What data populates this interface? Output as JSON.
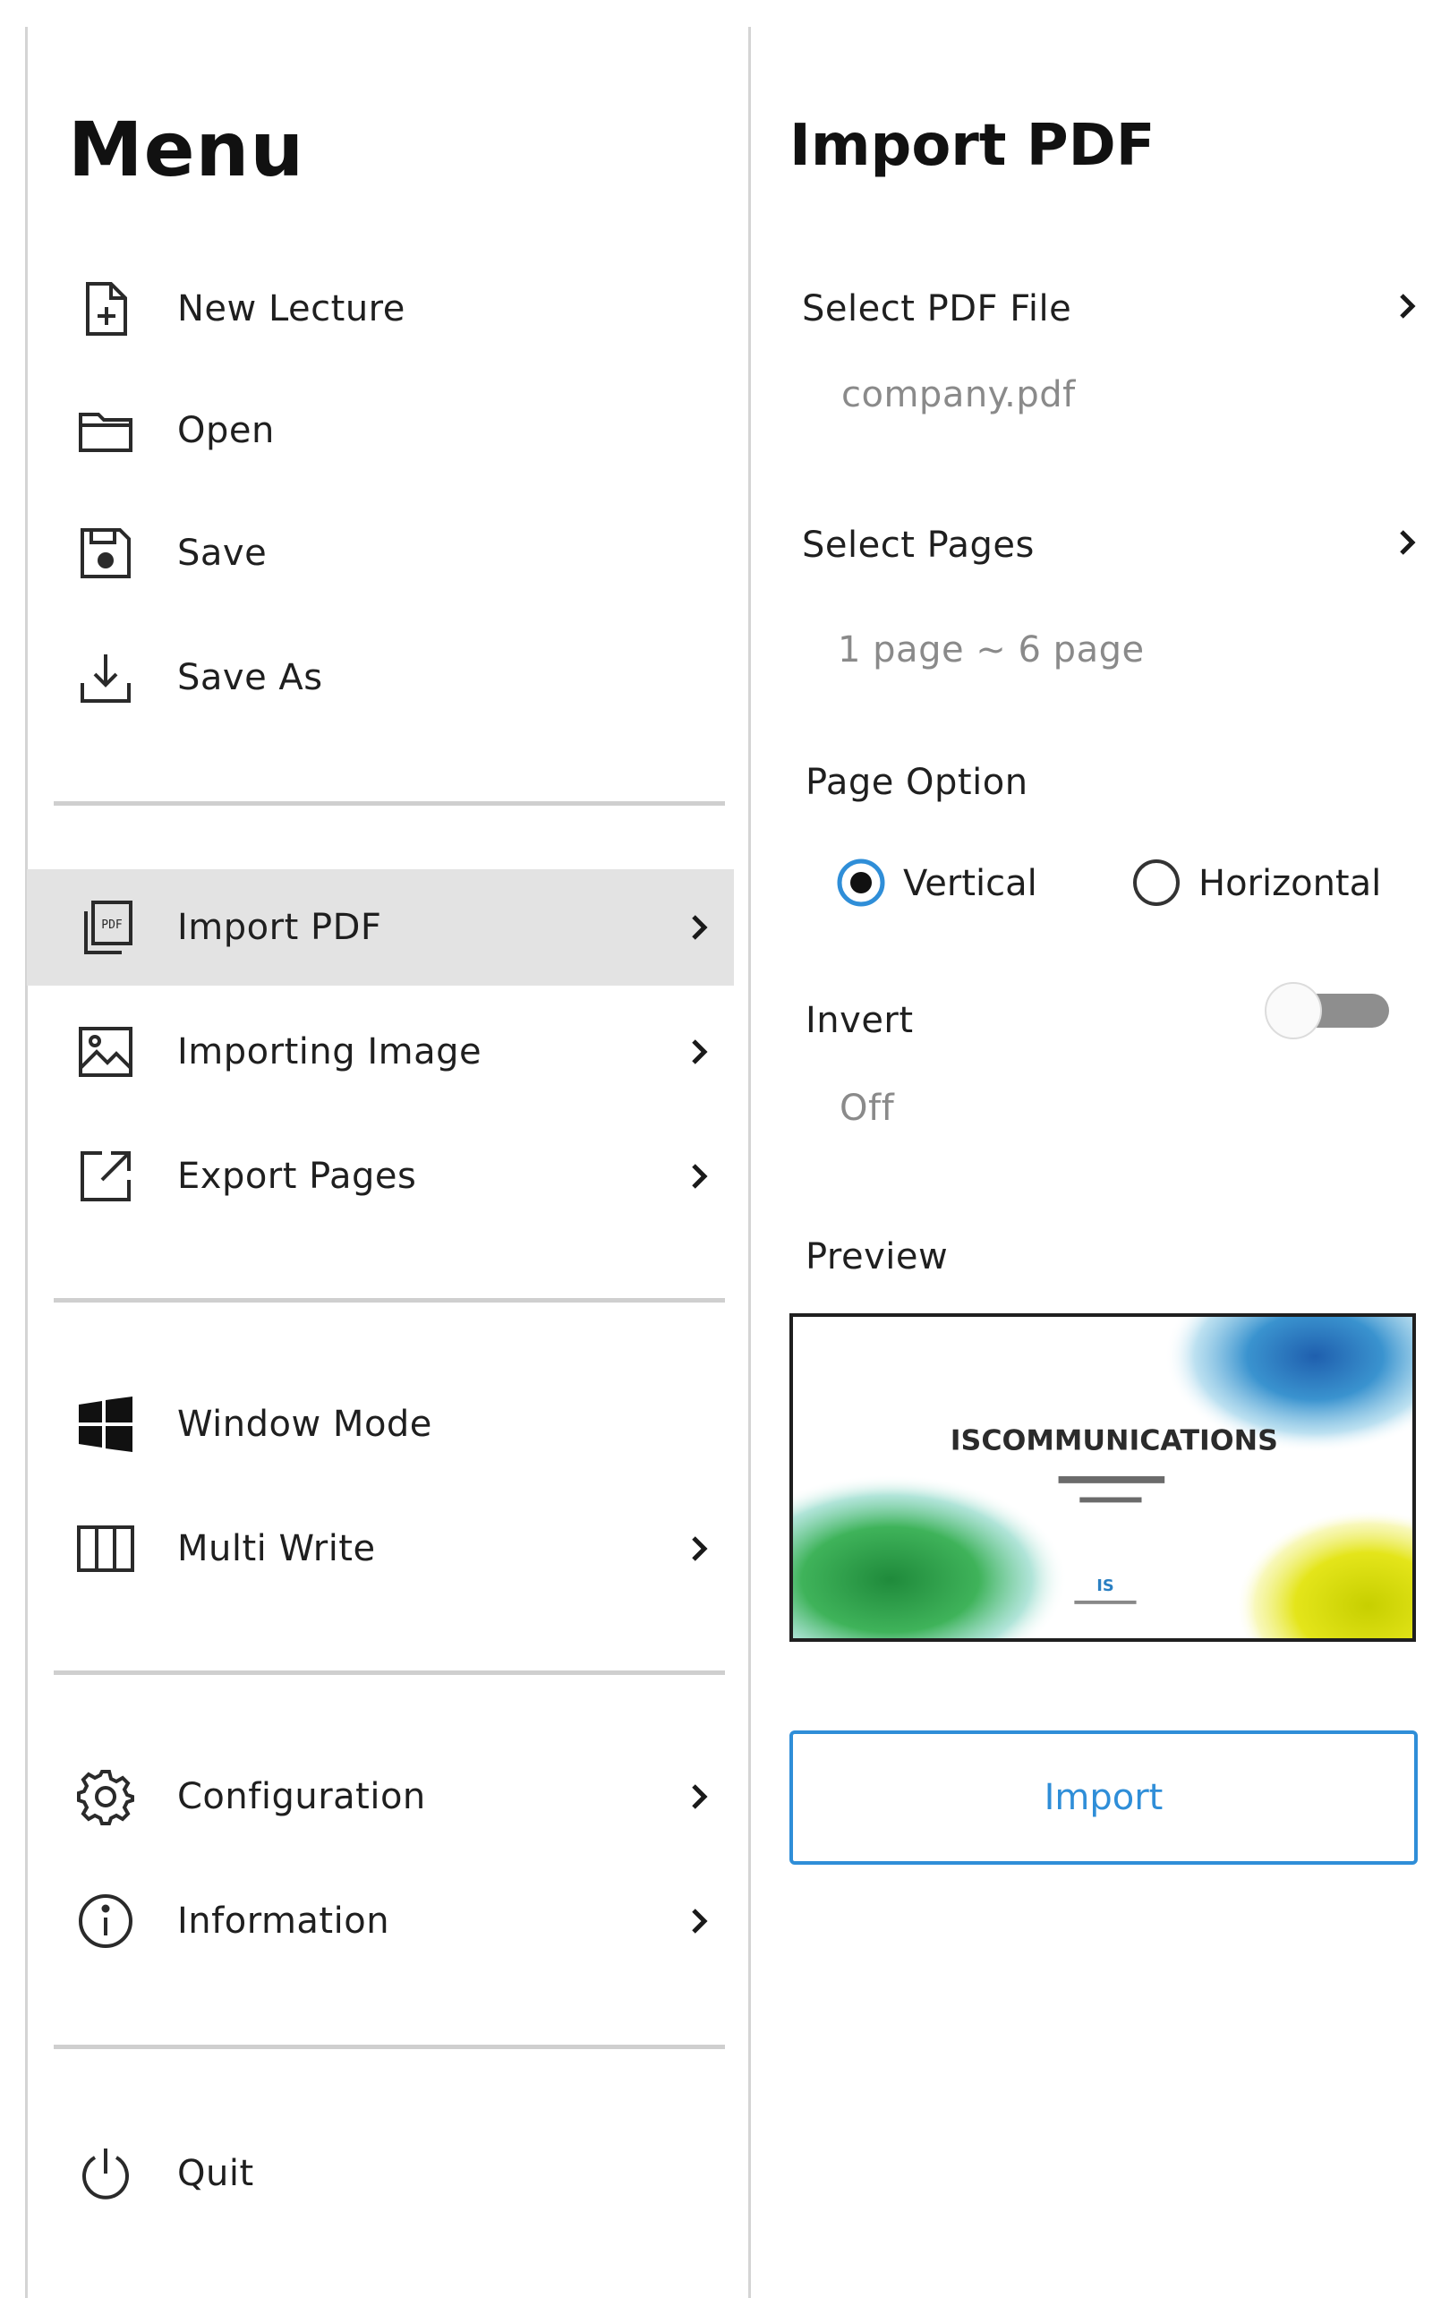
{
  "menu": {
    "title": "Menu",
    "items": [
      {
        "label": "New Lecture",
        "icon": "new-file-icon"
      },
      {
        "label": "Open",
        "icon": "folder-icon"
      },
      {
        "label": "Save",
        "icon": "save-icon"
      },
      {
        "label": "Save As",
        "icon": "download-icon"
      },
      {
        "label": "Import PDF",
        "icon": "pdf-icon",
        "active": true
      },
      {
        "label": "Importing Image",
        "icon": "image-icon"
      },
      {
        "label": "Export Pages",
        "icon": "export-icon"
      },
      {
        "label": "Window Mode",
        "icon": "windows-icon"
      },
      {
        "label": "Multi Write",
        "icon": "columns-icon"
      },
      {
        "label": "Configuration",
        "icon": "gear-icon"
      },
      {
        "label": "Information",
        "icon": "info-icon"
      },
      {
        "label": "Quit",
        "icon": "power-icon"
      }
    ]
  },
  "import_pdf": {
    "title": "Import PDF",
    "select_file_label": "Select PDF File",
    "selected_file": "company.pdf",
    "select_pages_label": "Select Pages",
    "page_range": "1 page ~ 6 page",
    "page_option_label": "Page Option",
    "options": [
      {
        "label": "Vertical",
        "selected": true
      },
      {
        "label": "Horizontal",
        "selected": false
      }
    ],
    "invert_label": "Invert",
    "invert_state": "Off",
    "preview_label": "Preview",
    "preview_slide": {
      "title": "ISCOMMUNICATIONS",
      "logo_text": "IS"
    },
    "import_button": "Import"
  },
  "colors": {
    "accent": "#2f8ed8",
    "active_bg": "#e3e3e3",
    "divider": "#cfcfcf",
    "muted_text": "#8a8a8a"
  }
}
